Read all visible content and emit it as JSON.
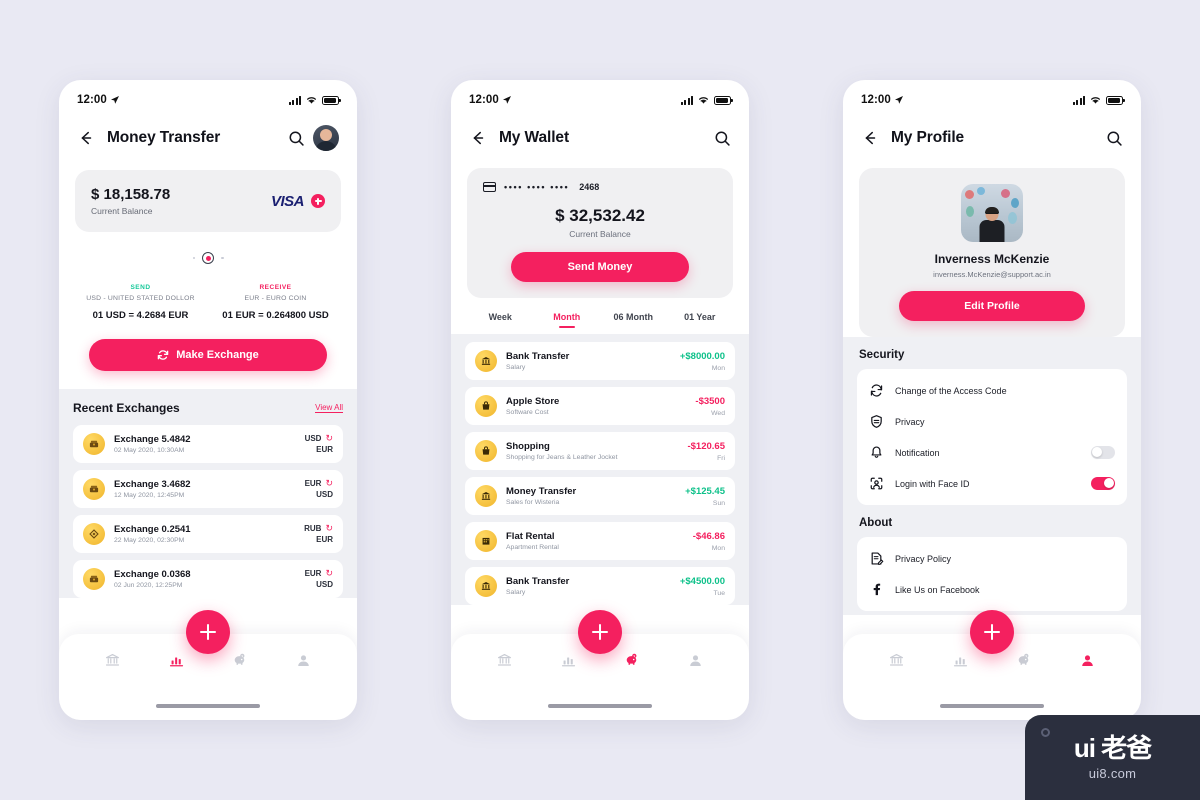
{
  "background": "#e9e9f3",
  "accent": "#f4205f",
  "positive": "#0ec18a",
  "statusbar": {
    "time": "12:00",
    "location_icon": "location-arrow-icon"
  },
  "phone1": {
    "nav": {
      "back_icon": "back-arrow-icon",
      "title": "Money Transfer",
      "search_icon": "search-icon",
      "avatar": "user-avatar"
    },
    "balance_card": {
      "amount": "$ 18,158.78",
      "label": "Current Balance",
      "brand": "VISA",
      "add_icon": "plus-circle-icon"
    },
    "send": {
      "tag": "SEND",
      "name": "USD - UNITED STATED DOLLOR",
      "rate": "01 USD = 4.2684 EUR"
    },
    "receive": {
      "tag": "RECEIVE",
      "name": "EUR - EURO COIN",
      "rate": "01 EUR = 0.264800 USD"
    },
    "exchange_button": {
      "label": "Make Exchange",
      "icon": "refresh-icon"
    },
    "section": {
      "title": "Recent Exchanges",
      "view_all": "View All"
    },
    "exchanges": [
      {
        "icon": "coin-stack-icon",
        "title": "Exchange 5.4842",
        "date": "02 May 2020, 10:30AM",
        "from": "USD",
        "to": "EUR"
      },
      {
        "icon": "coin-stack-icon",
        "title": "Exchange 3.4682",
        "date": "12 May 2020, 12:45PM",
        "from": "EUR",
        "to": "USD"
      },
      {
        "icon": "coin-diamond-icon",
        "title": "Exchange 0.2541",
        "date": "22 May 2020, 02:30PM",
        "from": "RUB",
        "to": "EUR"
      },
      {
        "icon": "coin-stack-icon",
        "title": "Exchange 0.0368",
        "date": "02 Jun 2020, 12:25PM",
        "from": "EUR",
        "to": "USD"
      }
    ],
    "bottom_nav": {
      "active_index": 1,
      "items": [
        "bank-icon",
        "chart-icon",
        "piggy-bank-icon",
        "person-icon"
      ],
      "fab": "add-icon"
    }
  },
  "phone2": {
    "nav": {
      "back_icon": "back-arrow-icon",
      "title": "My Wallet",
      "search_icon": "search-icon"
    },
    "wallet_card": {
      "card_icon": "credit-card-icon",
      "masked": "•••• •••• ••••",
      "last4": "2468",
      "amount": "$ 32,532.42",
      "label": "Current Balance",
      "send_button": "Send Money"
    },
    "tabs": [
      {
        "label": "Week",
        "active": false
      },
      {
        "label": "Month",
        "active": true
      },
      {
        "label": "06 Month",
        "active": false
      },
      {
        "label": "01 Year",
        "active": false
      }
    ],
    "transactions": [
      {
        "icon": "bank-icon",
        "title": "Bank Transfer",
        "sub": "Salary",
        "amount": "+$8000.00",
        "sign": "pos",
        "day": "Mon"
      },
      {
        "icon": "bag-icon",
        "title": "Apple Store",
        "sub": "Software Cost",
        "amount": "-$3500",
        "sign": "neg",
        "day": "Wed"
      },
      {
        "icon": "bag-icon",
        "title": "Shopping",
        "sub": "Shopping for Jeans & Leather Jocket",
        "amount": "-$120.65",
        "sign": "neg",
        "day": "Fri"
      },
      {
        "icon": "bank-icon",
        "title": "Money Transfer",
        "sub": "Sales for Wisteria",
        "amount": "+$125.45",
        "sign": "pos",
        "day": "Sun"
      },
      {
        "icon": "building-icon",
        "title": "Flat Rental",
        "sub": "Apartment Rental",
        "amount": "-$46.86",
        "sign": "neg",
        "day": "Mon"
      },
      {
        "icon": "bank-icon",
        "title": "Bank Transfer",
        "sub": "Salary",
        "amount": "+$4500.00",
        "sign": "pos",
        "day": "Tue"
      }
    ],
    "bottom_nav": {
      "active_index": 2,
      "items": [
        "bank-icon",
        "chart-icon",
        "piggy-bank-icon",
        "person-icon"
      ],
      "fab": "add-icon"
    }
  },
  "phone3": {
    "nav": {
      "back_icon": "back-arrow-icon",
      "title": "My Profile",
      "search_icon": "search-icon"
    },
    "profile": {
      "photo": "profile-photo",
      "name": "Inverness McKenzie",
      "email": "inverness.McKenzie@support.ac.in",
      "edit_button": "Edit Profile"
    },
    "security": {
      "title": "Security",
      "items": [
        {
          "icon": "refresh-lock-icon",
          "label": "Change of the Access Code",
          "toggle": null
        },
        {
          "icon": "privacy-mask-icon",
          "label": "Privacy",
          "toggle": null
        },
        {
          "icon": "bell-icon",
          "label": "Notification",
          "toggle": "off"
        },
        {
          "icon": "face-id-icon",
          "label": "Login with Face ID",
          "toggle": "on"
        }
      ]
    },
    "about": {
      "title": "About",
      "items": [
        {
          "icon": "document-edit-icon",
          "label": "Privacy Policy"
        },
        {
          "icon": "facebook-icon",
          "label": "Like Us on Facebook"
        }
      ]
    },
    "bottom_nav": {
      "active_index": 3,
      "items": [
        "bank-icon",
        "chart-icon",
        "piggy-bank-icon",
        "person-icon"
      ],
      "fab": "add-icon"
    }
  },
  "watermark": {
    "main": "ui 老爸",
    "sub": "ui8.com"
  }
}
